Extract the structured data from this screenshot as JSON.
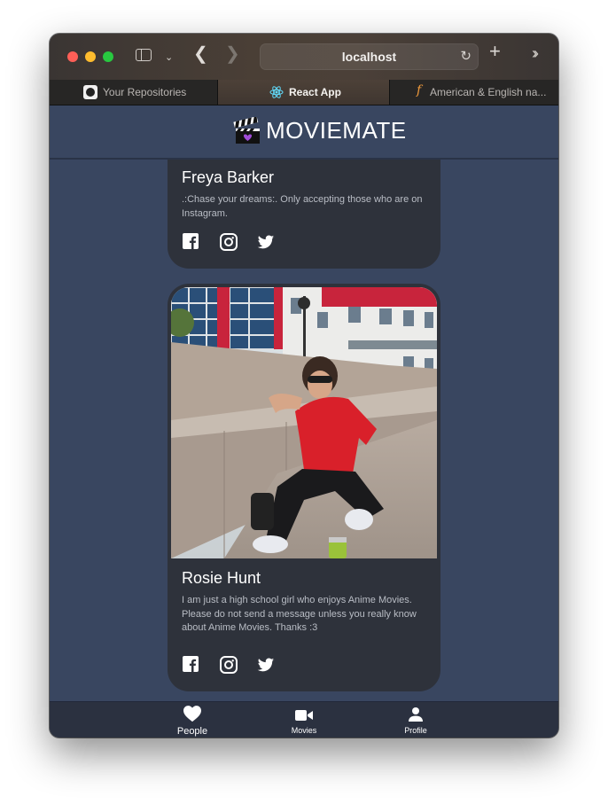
{
  "browser": {
    "address": "localhost",
    "tabs": [
      {
        "label": "Your Repositories",
        "icon": "github-icon"
      },
      {
        "label": "React App",
        "icon": "react-icon",
        "active": true
      },
      {
        "label": "American & English na...",
        "icon": "fontawesome-icon"
      }
    ]
  },
  "app": {
    "brand": "MOVIEMATE",
    "accent": "#394660"
  },
  "profiles": [
    {
      "name": "Freya Barker",
      "bio": ".:Chase your dreams:. Only accepting those who are on Instagram."
    },
    {
      "name": "Rosie Hunt",
      "bio": "I am just a high school girl who enjoys Anime Movies. Please do not send a message unless you really know about Anime Movies. Thanks :3"
    }
  ],
  "nav": {
    "items": [
      {
        "label": "People",
        "icon": "heart-icon",
        "active": true
      },
      {
        "label": "Movies",
        "icon": "video-camera-icon"
      },
      {
        "label": "Profile",
        "icon": "person-icon"
      }
    ]
  }
}
